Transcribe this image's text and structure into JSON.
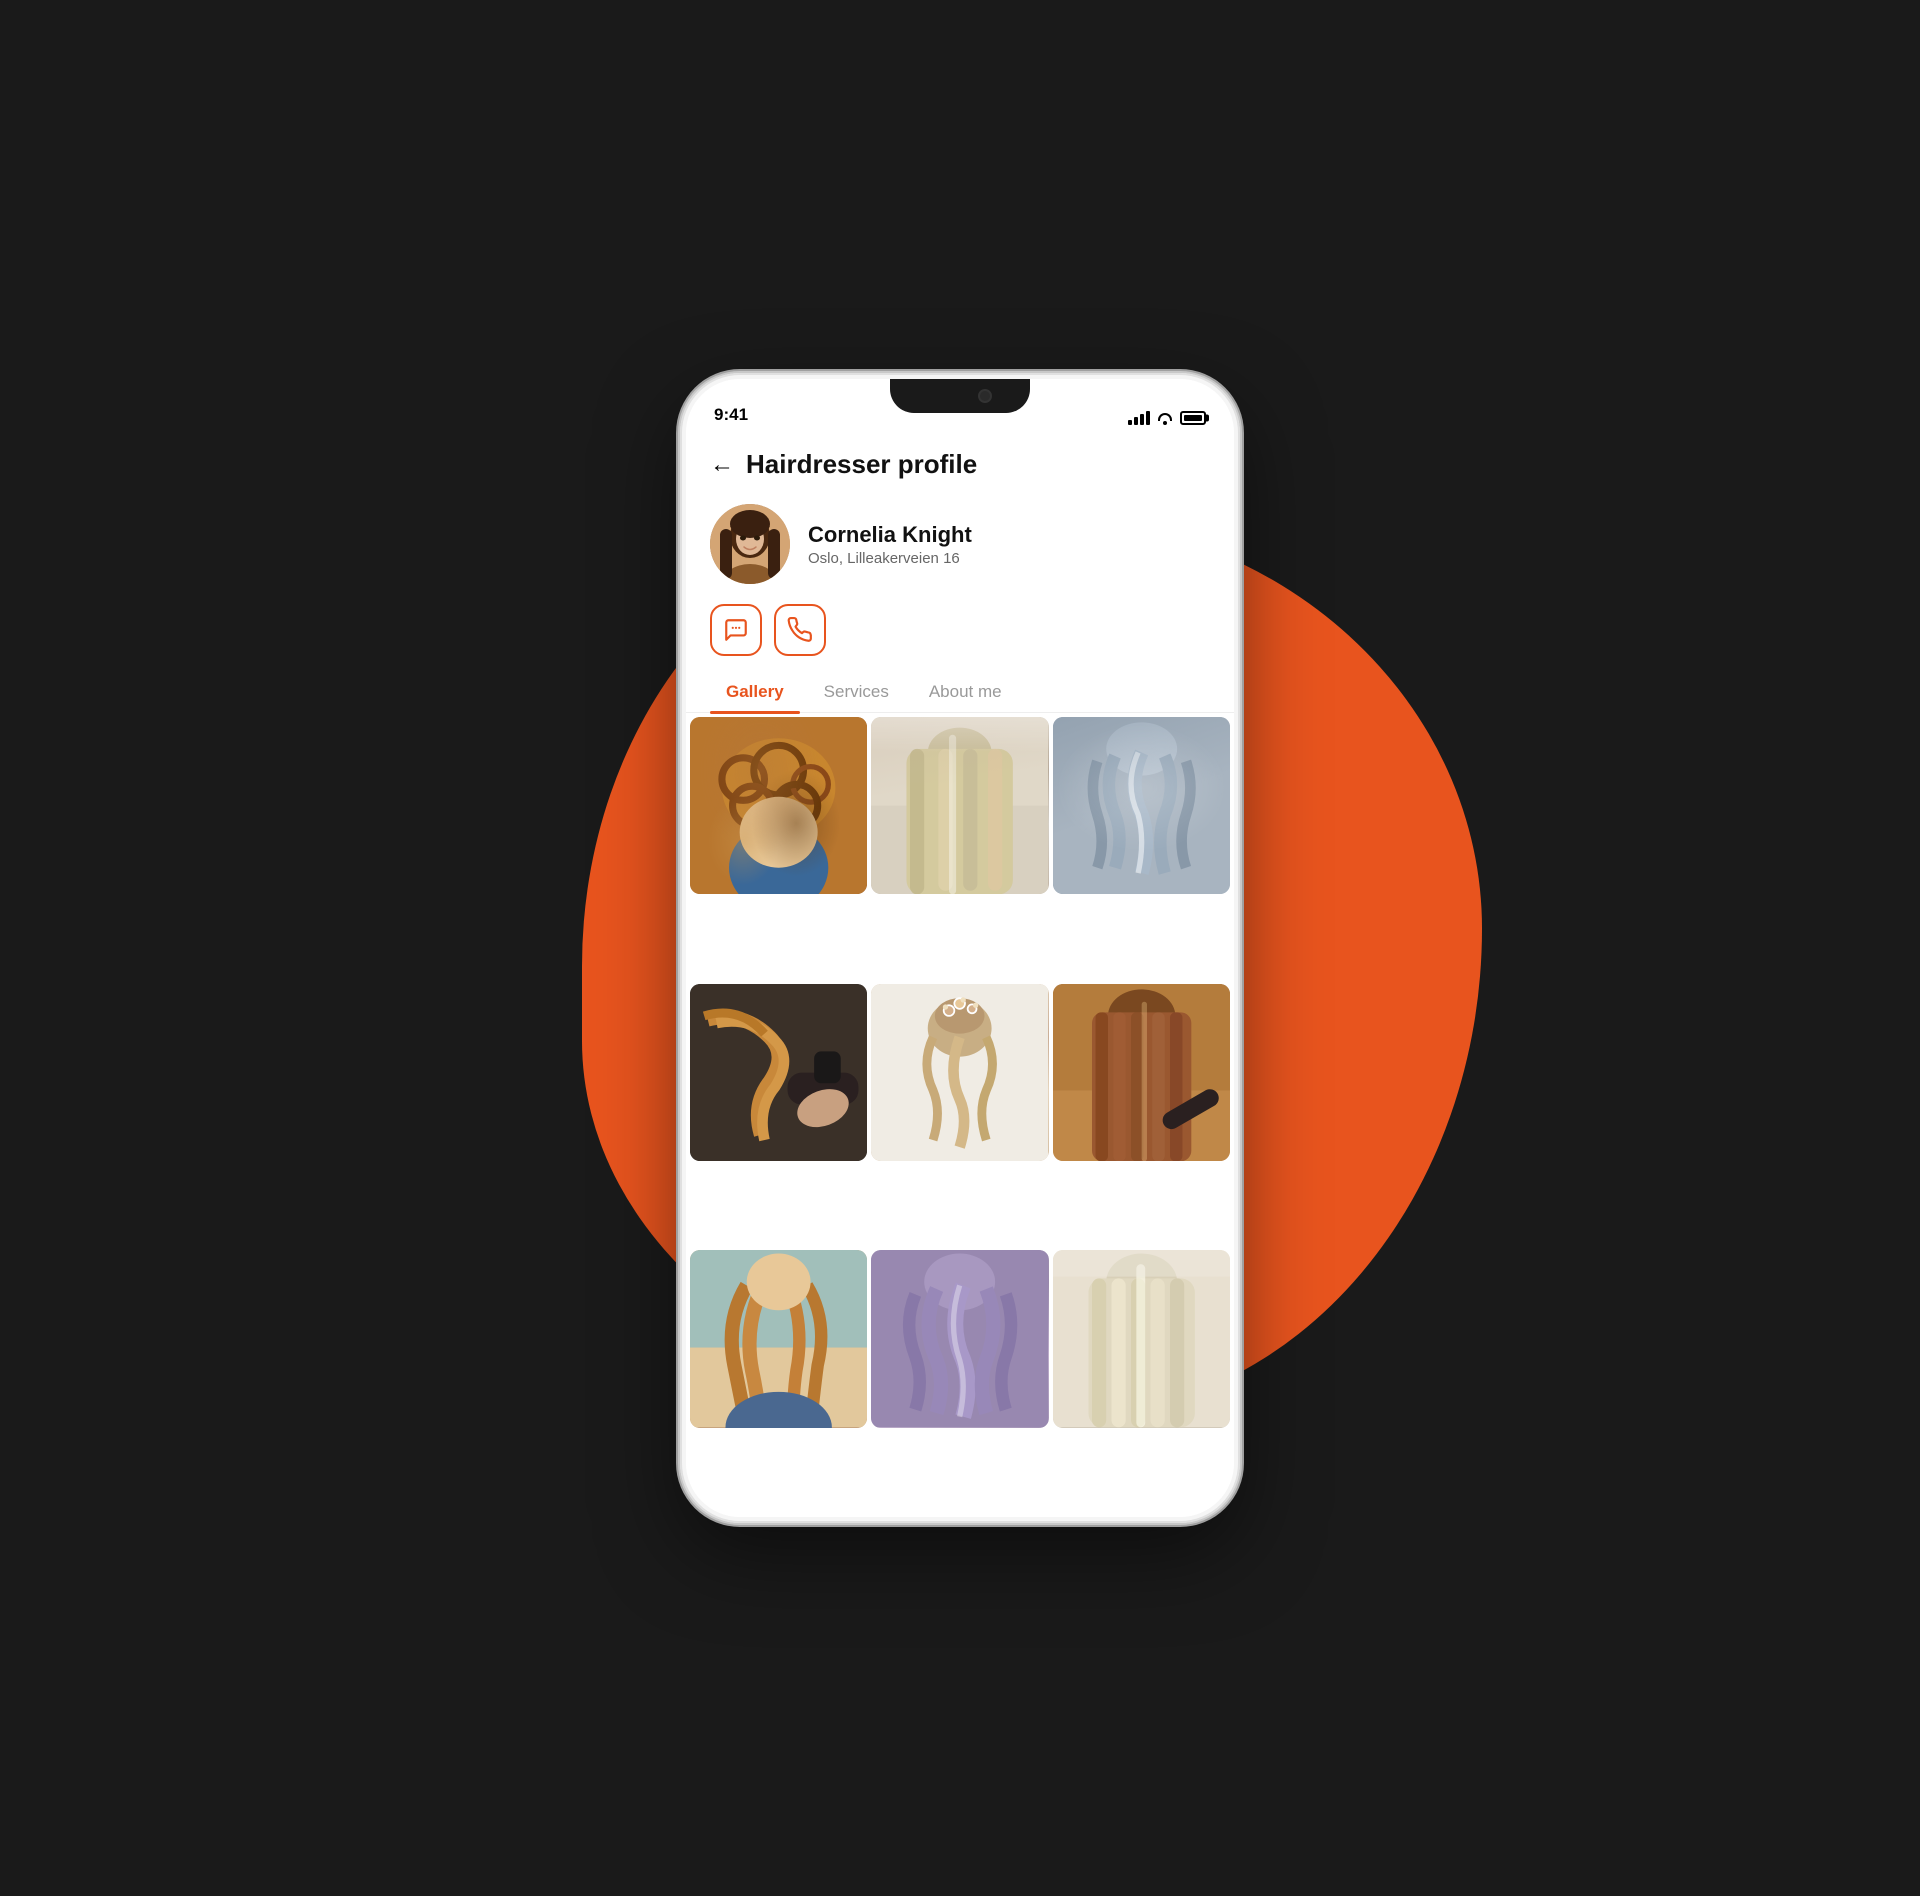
{
  "background": {
    "color": "#1a1a1a",
    "blob_color": "#E8541E"
  },
  "status_bar": {
    "time": "9:41",
    "signal": "signal",
    "wifi": "wifi",
    "battery": "battery"
  },
  "header": {
    "back_label": "←",
    "title": "Hairdresser profile"
  },
  "profile": {
    "name": "Cornelia Knight",
    "location": "Oslo, Lilleakerveien 16"
  },
  "action_buttons": {
    "message_label": "message",
    "call_label": "call"
  },
  "tabs": [
    {
      "id": "gallery",
      "label": "Gallery",
      "active": true
    },
    {
      "id": "services",
      "label": "Services",
      "active": false
    },
    {
      "id": "about",
      "label": "About me",
      "active": false
    }
  ],
  "gallery": {
    "items": [
      {
        "id": 1,
        "style": "curly",
        "alt": "Curly hair style"
      },
      {
        "id": 2,
        "style": "long-straight",
        "alt": "Long straight blonde hair"
      },
      {
        "id": 3,
        "style": "wavy-silver",
        "alt": "Wavy silver hair"
      },
      {
        "id": 4,
        "style": "blowdry",
        "alt": "Blow dry styling"
      },
      {
        "id": 5,
        "style": "updo-bridal",
        "alt": "Bridal updo"
      },
      {
        "id": 6,
        "style": "long-brown",
        "alt": "Long brown straight hair"
      },
      {
        "id": 7,
        "style": "long-wavy",
        "alt": "Long wavy hair from behind"
      },
      {
        "id": 8,
        "style": "wavy-lilac",
        "alt": "Wavy lilac toned hair"
      },
      {
        "id": 9,
        "style": "straight-blonde",
        "alt": "Straight blonde hair"
      }
    ]
  }
}
